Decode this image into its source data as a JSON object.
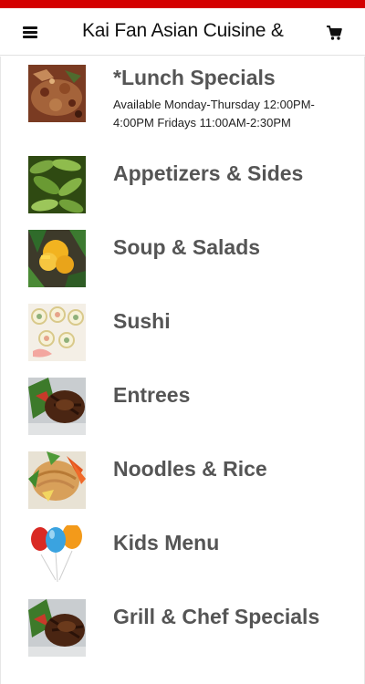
{
  "header": {
    "title": "Kai Fan Asian Cuisine &",
    "menu_icon": "hamburger-menu-icon",
    "cart_icon": "shopping-cart-icon",
    "accent_color": "#d40000"
  },
  "categories": [
    {
      "name": "*Lunch Specials",
      "description": "Available Monday-Thursday 12:00PM-4:00PM Fridays 11:00AM-2:30PM",
      "image": "fried-rice-dish"
    },
    {
      "name": "Appetizers & Sides",
      "image": "edamame"
    },
    {
      "name": "Soup & Salads",
      "image": "mango-salad"
    },
    {
      "name": "Sushi",
      "image": "sushi-rolls"
    },
    {
      "name": "Entrees",
      "image": "grilled-entree"
    },
    {
      "name": "Noodles & Rice",
      "image": "pad-thai-noodles"
    },
    {
      "name": "Kids Menu",
      "image": "balloons"
    },
    {
      "name": "Grill & Chef Specials",
      "image": "grilled-meat-plate"
    }
  ]
}
